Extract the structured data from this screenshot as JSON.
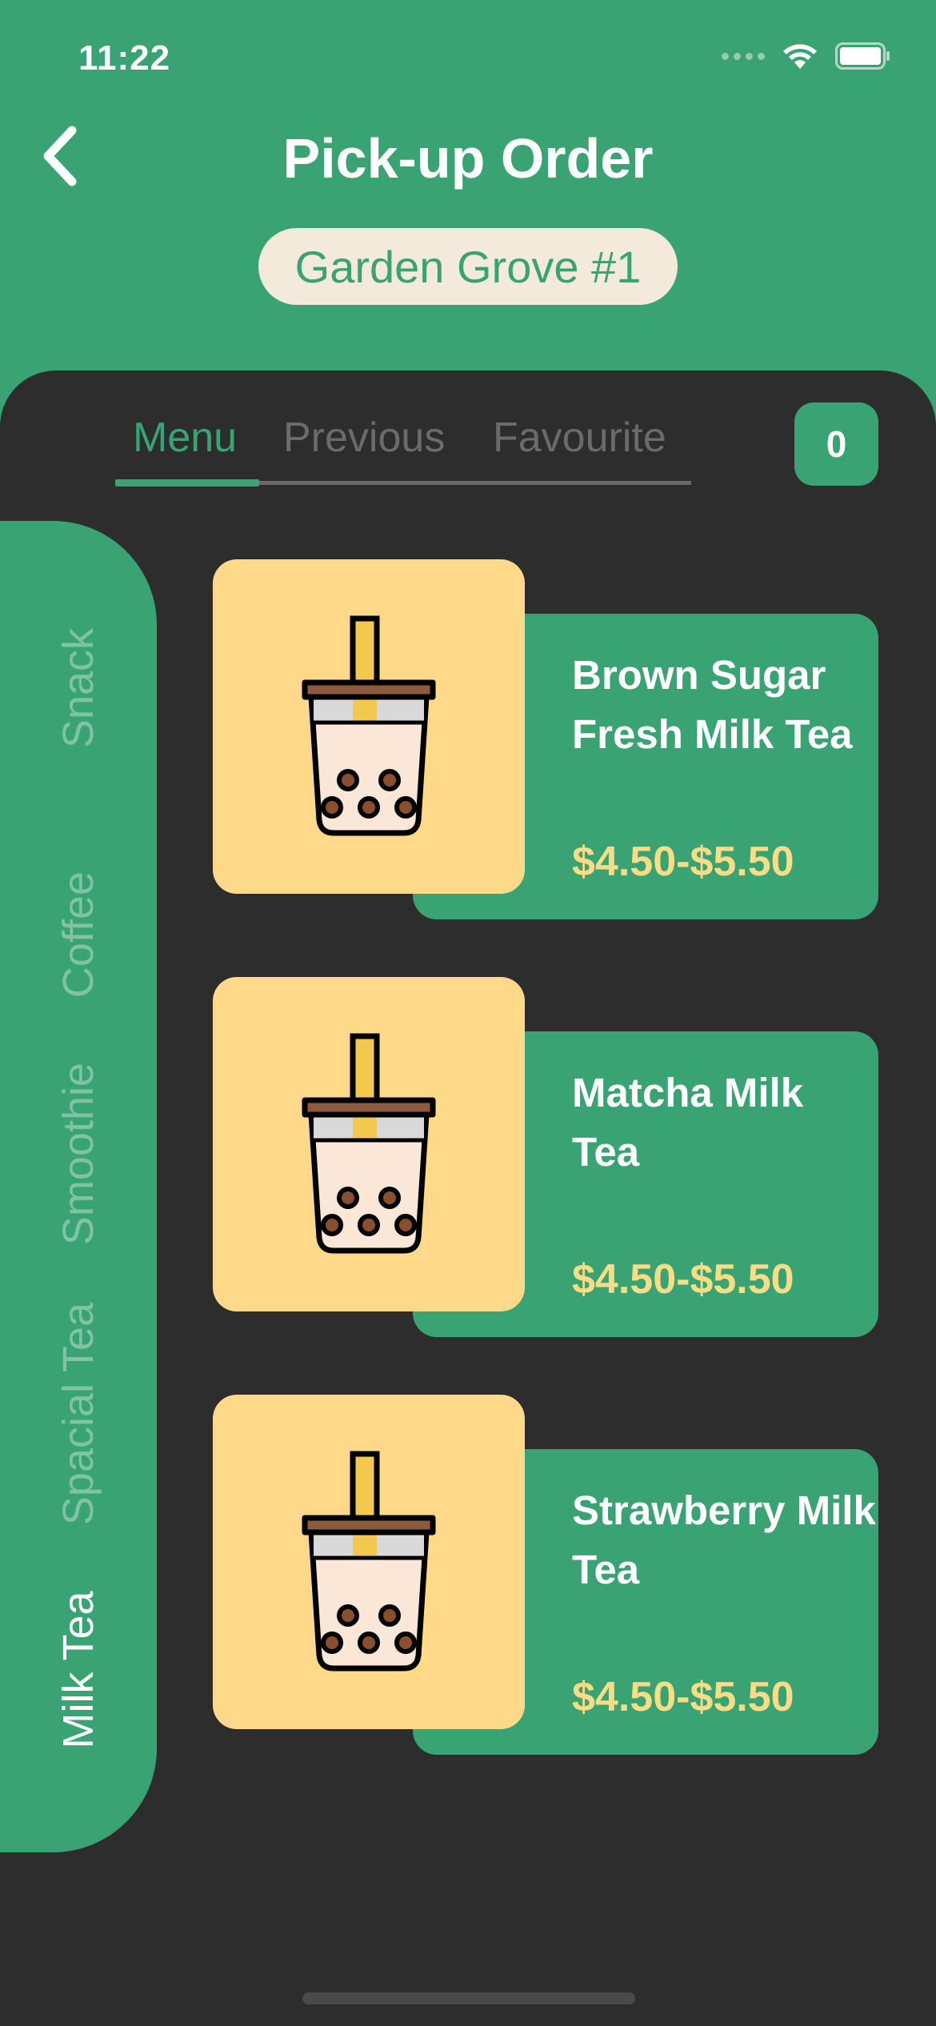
{
  "status_bar": {
    "time": "11:22"
  },
  "header": {
    "title": "Pick-up Order",
    "store": "Garden Grove #1"
  },
  "tabs": [
    {
      "label": "Menu",
      "active": true
    },
    {
      "label": "Previous",
      "active": false
    },
    {
      "label": "Favourite",
      "active": false
    }
  ],
  "cart": {
    "count": "0"
  },
  "categories": [
    {
      "label": "Milk Tea",
      "active": true
    },
    {
      "label": "Spacial Tea",
      "active": false
    },
    {
      "label": "Smoothie",
      "active": false
    },
    {
      "label": "Coffee",
      "active": false
    },
    {
      "label": "Snack",
      "active": false
    }
  ],
  "products": [
    {
      "name": "Brown Sugar Fresh Milk Tea",
      "price": "$4.50-$5.50",
      "icon": "bubble-tea-icon"
    },
    {
      "name": "Matcha Milk Tea",
      "price": "$4.50-$5.50",
      "icon": "bubble-tea-icon"
    },
    {
      "name": "Strawberry Milk Tea",
      "price": "$4.50-$5.50",
      "icon": "bubble-tea-icon"
    }
  ],
  "colors": {
    "primary_green": "#3aa373",
    "panel_dark": "#2d2d2d",
    "pill_bg": "#f4eadc",
    "thumb_bg": "#ffd98a",
    "price_yellow": "#f9dd86"
  }
}
